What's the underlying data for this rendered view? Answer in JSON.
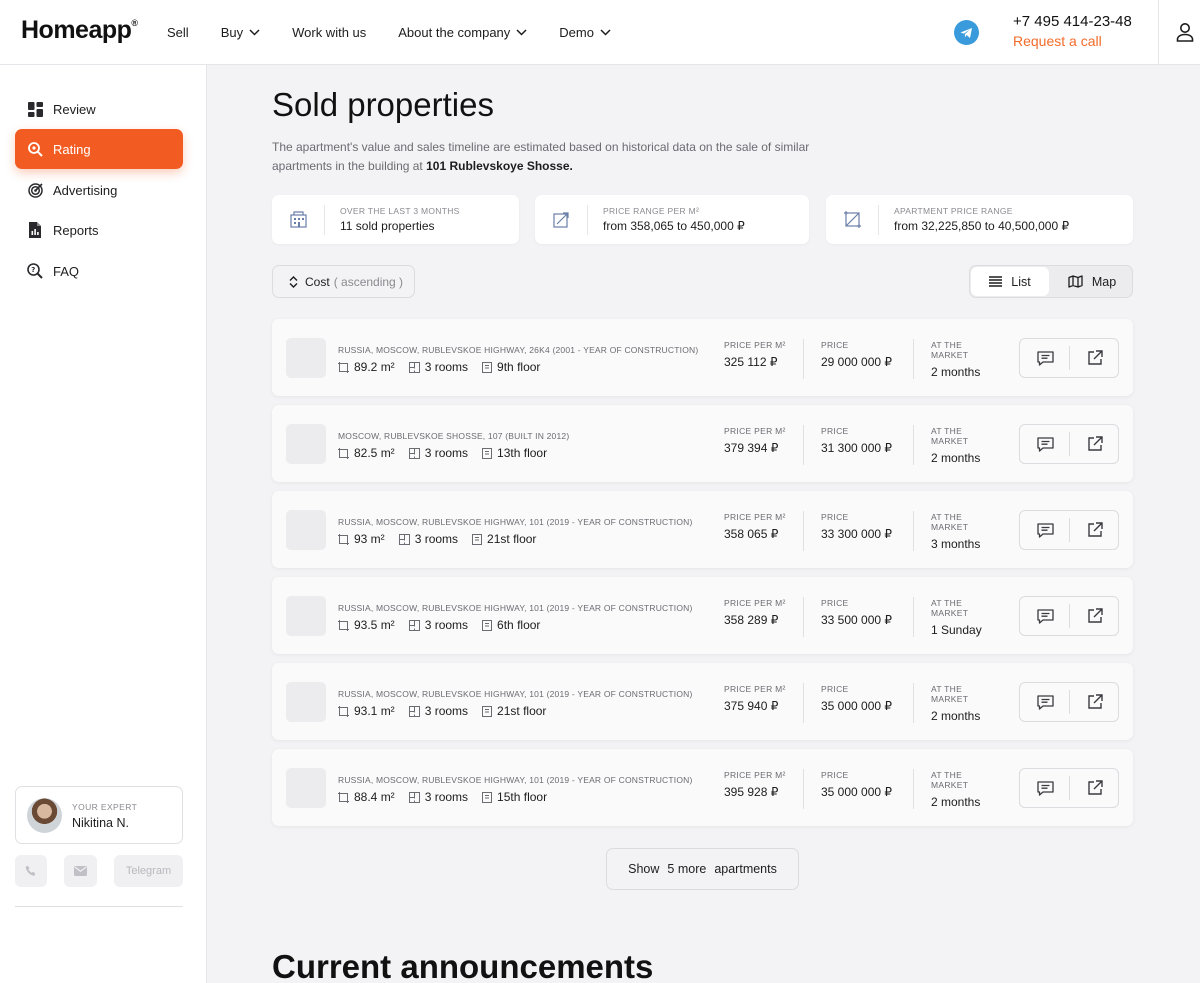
{
  "header": {
    "logo": "Homeapp",
    "logo_mark": "®",
    "nav": [
      {
        "label": "Sell"
      },
      {
        "label": "Buy"
      },
      {
        "label": "Work with us"
      },
      {
        "label": "About the company"
      },
      {
        "label": "Demo"
      }
    ],
    "phone": "+7 495 414-23-48",
    "request_call": "Request a call"
  },
  "sidebar": {
    "items": [
      {
        "label": "Review",
        "icon": "dashboard-icon"
      },
      {
        "label": "Rating",
        "icon": "magnifier-icon"
      },
      {
        "label": "Advertising",
        "icon": "target-icon"
      },
      {
        "label": "Reports",
        "icon": "report-icon"
      },
      {
        "label": "FAQ",
        "icon": "faq-icon"
      }
    ],
    "active_color": "#f25c22",
    "expert": {
      "label": "YOUR EXPERT",
      "name": "Nikitina N."
    },
    "contacts": {
      "telegram": "Telegram"
    }
  },
  "main": {
    "title": "Sold properties",
    "description": "The apartment's value and sales timeline are estimated based on historical data on the sale of similar apartments in the building at ",
    "description_bold": "101 Rublevskoye Shosse.",
    "stats": [
      {
        "label": "OVER THE LAST 3 MONTHS",
        "value": "11 sold properties"
      },
      {
        "label": "PRICE RANGE PER M²",
        "value": "from 358,065 to 450,000 ₽"
      },
      {
        "label": "APARTMENT PRICE RANGE",
        "value": "from 32,225,850 to 40,500,000 ₽"
      }
    ],
    "sort": {
      "label": "Cost",
      "order": "( ascending )"
    },
    "view": {
      "list": "List",
      "map": "Map"
    },
    "columns": {
      "price_per_m2": "PRICE PER M²",
      "price": "PRICE",
      "at_market": "AT THE MARKET"
    },
    "properties": [
      {
        "address": "RUSSIA, MOSCOW, RUBLEVSKOE HIGHWAY, 26K4 (2001 - YEAR OF CONSTRUCTION)",
        "area": "89.2 m²",
        "rooms": "3 rooms",
        "floor": "9th floor",
        "price_per_m2": "325 112 ₽",
        "price": "29 000 000 ₽",
        "market": "2 months"
      },
      {
        "address": "MOSCOW, RUBLEVSKOE SHOSSE, 107 (BUILT IN 2012)",
        "area": "82.5 m²",
        "rooms": "3 rooms",
        "floor": "13th floor",
        "price_per_m2": "379 394 ₽",
        "price": "31 300 000 ₽",
        "market": "2 months"
      },
      {
        "address": "RUSSIA, MOSCOW, RUBLEVSKOE HIGHWAY, 101 (2019 - YEAR OF CONSTRUCTION)",
        "area": "93 m²",
        "rooms": "3 rooms",
        "floor": "21st floor",
        "price_per_m2": "358 065 ₽",
        "price": "33 300 000 ₽",
        "market": "3 months"
      },
      {
        "address": "RUSSIA, MOSCOW, RUBLEVSKOE HIGHWAY, 101 (2019 - YEAR OF CONSTRUCTION)",
        "area": "93.5 m²",
        "rooms": "3 rooms",
        "floor": "6th floor",
        "price_per_m2": "358 289 ₽",
        "price": "33 500 000 ₽",
        "market": "1 Sunday"
      },
      {
        "address": "RUSSIA, MOSCOW, RUBLEVSKOE HIGHWAY, 101 (2019 - YEAR OF CONSTRUCTION)",
        "area": "93.1 m²",
        "rooms": "3 rooms",
        "floor": "21st floor",
        "price_per_m2": "375 940 ₽",
        "price": "35 000 000 ₽",
        "market": "2 months"
      },
      {
        "address": "RUSSIA, MOSCOW, RUBLEVSKOE HIGHWAY, 101 (2019 - YEAR OF CONSTRUCTION)",
        "area": "88.4 m²",
        "rooms": "3 rooms",
        "floor": "15th floor",
        "price_per_m2": "395 928 ₽",
        "price": "35 000 000 ₽",
        "market": "2 months"
      }
    ],
    "show_more": {
      "prefix": "Show",
      "count": "5 more",
      "suffix": "apartments"
    },
    "section2_title": "Current announcements"
  }
}
